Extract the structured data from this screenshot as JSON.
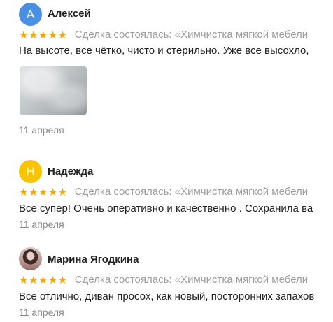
{
  "reviews": [
    {
      "avatar_letter": "А",
      "author": "Алексей",
      "stars": "★★★★★",
      "deal": "Сделка состоялась: «Химчистка мягкой мебели",
      "text": "На высоте, все чётко, чисто и стерильно. Уже все высохло,",
      "date": "11 апреля",
      "has_photo": true
    },
    {
      "avatar_letter": "Н",
      "author": "Надежда",
      "stars": "★★★★★",
      "deal": "Сделка состоялась: «Химчистка мягкой мебели",
      "text": "Все супер! Очень оперативно и качественно . Сохранила ва",
      "date": "11 апреля"
    },
    {
      "avatar_letter": "",
      "author": "Марина Ягодкина",
      "stars": "★★★★★",
      "deal": "Сделка состоялась: «Химчистка мягкой мебели",
      "text": "Все отлично, диван просох, как новый, посторонних запахов",
      "date": "11 апреля"
    }
  ],
  "colors": {
    "star": "#f7a600",
    "avatar_a": "#4a90e2",
    "avatar_n": "#f6c400",
    "muted": "#9d9d9d"
  }
}
